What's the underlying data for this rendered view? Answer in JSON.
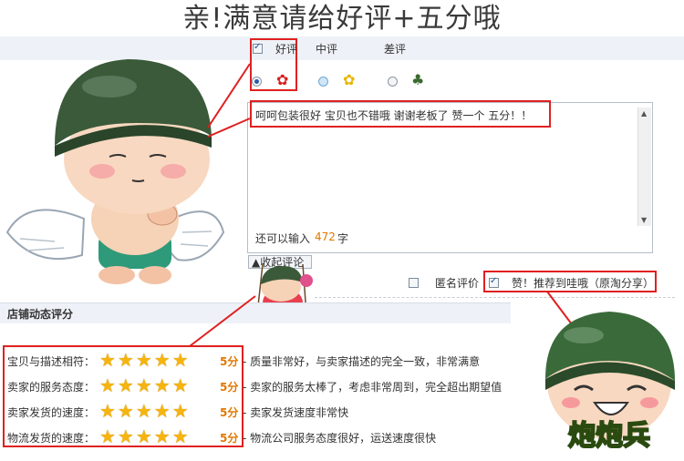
{
  "header": {
    "title": "亲!满意请给好评+五分哦"
  },
  "rating": {
    "options": [
      {
        "label": "好评",
        "icon": "red-flower-icon",
        "checked": true
      },
      {
        "label": "中评",
        "icon": "yellow-flower-icon",
        "checked": false
      },
      {
        "label": "差评",
        "icon": "dead-plant-icon",
        "checked": false
      }
    ]
  },
  "comment": {
    "text": "呵呵包装很好  宝贝也不错哦  谢谢老板了  赞一个  五分！！",
    "remaining_prefix": "还可以输入",
    "remaining_count": "472",
    "remaining_suffix": "字"
  },
  "controls": {
    "collapse_label": "收起评论",
    "anonymous_label": "匿名评价",
    "share_label": "赞！推荐到哇哦（原淘分享）"
  },
  "shop": {
    "title": "店铺动态评分",
    "rows": [
      {
        "label": "宝贝与描述相符：",
        "stars": 5,
        "score": "5分",
        "desc": "- 质量非常好，与卖家描述的完全一致，非常满意"
      },
      {
        "label": "卖家的服务态度：",
        "stars": 5,
        "score": "5分",
        "desc": "- 卖家的服务太棒了，考虑非常周到，完全超出期望值"
      },
      {
        "label": "卖家发货的速度：",
        "stars": 5,
        "score": "5分",
        "desc": "- 卖家发货速度非常快"
      },
      {
        "label": "物流发货的速度：",
        "stars": 5,
        "score": "5分",
        "desc": "- 物流公司服务态度很好，运送速度很快"
      }
    ]
  },
  "colors": {
    "accent_red": "#e02020",
    "star": "#f6b40e",
    "score": "#e07800"
  },
  "logo": {
    "text": "炮炮兵"
  }
}
